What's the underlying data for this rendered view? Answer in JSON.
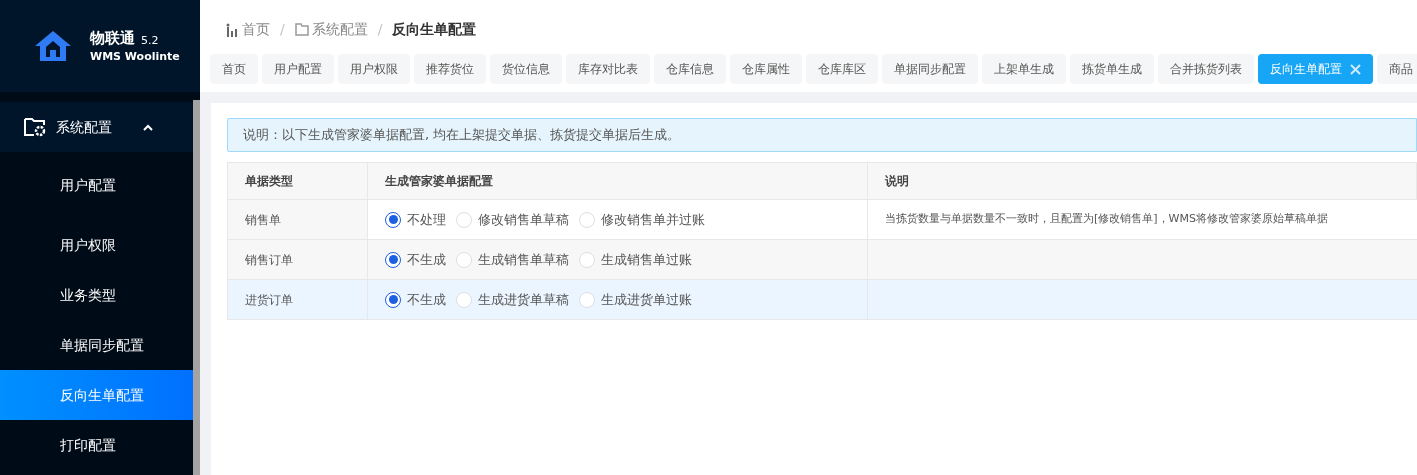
{
  "logo": {
    "name": "物联通",
    "version": "5.2",
    "subtitle": "WMS Woolinte"
  },
  "sidebar": {
    "group": {
      "label": "系统配置",
      "expanded": true
    },
    "items": [
      {
        "label": "用户配置",
        "selected": false
      },
      {
        "label": "用户权限",
        "selected": false
      },
      {
        "label": "业务类型",
        "selected": false
      },
      {
        "label": "单据同步配置",
        "selected": false
      },
      {
        "label": "反向生单配置",
        "selected": true
      },
      {
        "label": "打印配置",
        "selected": false
      }
    ]
  },
  "breadcrumb": [
    "首页",
    "系统配置",
    "反向生单配置"
  ],
  "breadcrumb_separator": "/",
  "tabs": [
    {
      "label": "首页",
      "selected": false
    },
    {
      "label": "用户配置",
      "selected": false
    },
    {
      "label": "用户权限",
      "selected": false
    },
    {
      "label": "推荐货位",
      "selected": false
    },
    {
      "label": "货位信息",
      "selected": false
    },
    {
      "label": "库存对比表",
      "selected": false
    },
    {
      "label": "仓库信息",
      "selected": false
    },
    {
      "label": "仓库属性",
      "selected": false
    },
    {
      "label": "仓库库区",
      "selected": false
    },
    {
      "label": "单据同步配置",
      "selected": false
    },
    {
      "label": "上架单生成",
      "selected": false
    },
    {
      "label": "拣货单生成",
      "selected": false
    },
    {
      "label": "合并拣货列表",
      "selected": false
    },
    {
      "label": "反向生单配置",
      "selected": true
    },
    {
      "label": "商品",
      "selected": false
    }
  ],
  "notice": "说明：以下生成管家婆单据配置, 均在上架提交单据、拣货提交单据后生成。",
  "table": {
    "columns": [
      "单据类型",
      "生成管家婆单据配置",
      "说明"
    ],
    "rows": [
      {
        "type": "销售单",
        "highlighted": false,
        "options": [
          {
            "label": "不处理",
            "selected": true
          },
          {
            "label": "修改销售单草稿",
            "selected": false
          },
          {
            "label": "修改销售单并过账",
            "selected": false
          }
        ],
        "note": "当拣货数量与单据数量不一致时，且配置为[修改销售单]，WMS将修改管家婆原始草稿单据"
      },
      {
        "type": "销售订单",
        "highlighted": false,
        "options": [
          {
            "label": "不生成",
            "selected": true
          },
          {
            "label": "生成销售单草稿",
            "selected": false
          },
          {
            "label": "生成销售单过账",
            "selected": false
          }
        ]
      },
      {
        "type": "进货订单",
        "highlighted": true,
        "options": [
          {
            "label": "不生成",
            "selected": true
          },
          {
            "label": "生成进货单草稿",
            "selected": false
          },
          {
            "label": "生成进货单过账",
            "selected": false
          }
        ]
      }
    ]
  }
}
